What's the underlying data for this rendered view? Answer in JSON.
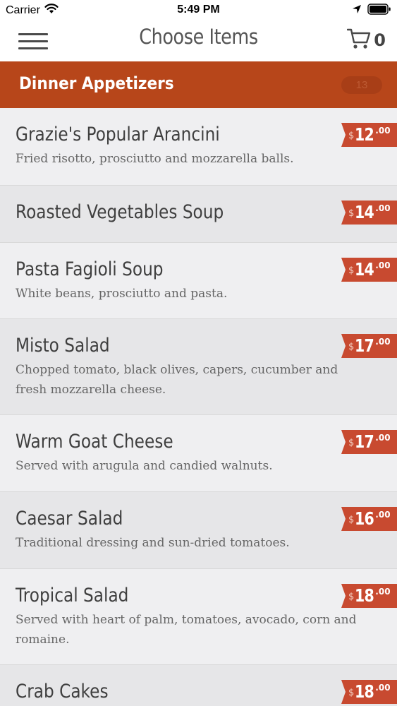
{
  "status_bar": {
    "carrier": "Carrier",
    "time": "5:49 PM",
    "icons": [
      "wifi-icon",
      "location-arrow-icon",
      "battery-icon"
    ]
  },
  "nav": {
    "title": "Choose Items",
    "cart_count": "0",
    "icons": [
      "hamburger-menu-icon",
      "cart-icon"
    ]
  },
  "category": {
    "title": "Dinner Appetizers",
    "badge": "13",
    "color": "#b7461a"
  },
  "price_tag_color": "#c84a30",
  "items": [
    {
      "name": "Grazie's Popular Arancini",
      "description": "Fried risotto, prosciutto and mozzarella balls.",
      "currency": "$",
      "price_whole": "12",
      "price_cents": ".00"
    },
    {
      "name": "Roasted Vegetables Soup",
      "description": "",
      "currency": "$",
      "price_whole": "14",
      "price_cents": ".00"
    },
    {
      "name": "Pasta Fagioli Soup",
      "description": "White beans, prosciutto and pasta.",
      "currency": "$",
      "price_whole": "14",
      "price_cents": ".00"
    },
    {
      "name": "Misto Salad",
      "description": "Chopped tomato, black olives, capers, cucumber and fresh mozzarella cheese.",
      "currency": "$",
      "price_whole": "17",
      "price_cents": ".00"
    },
    {
      "name": "Warm Goat Cheese",
      "description": "Served with arugula and candied walnuts.",
      "currency": "$",
      "price_whole": "17",
      "price_cents": ".00"
    },
    {
      "name": "Caesar Salad",
      "description": "Traditional dressing and sun-dried tomatoes.",
      "currency": "$",
      "price_whole": "16",
      "price_cents": ".00"
    },
    {
      "name": "Tropical Salad",
      "description": "Served with heart of palm, tomatoes, avocado, corn and romaine.",
      "currency": "$",
      "price_whole": "18",
      "price_cents": ".00"
    },
    {
      "name": "Crab Cakes",
      "description": "",
      "currency": "$",
      "price_whole": "18",
      "price_cents": ".00"
    }
  ]
}
